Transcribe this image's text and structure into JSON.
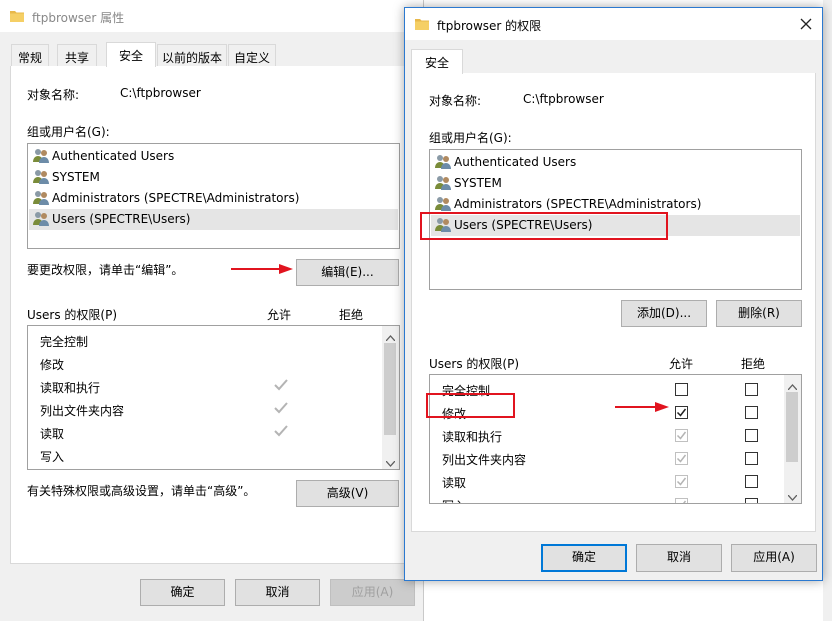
{
  "props_window": {
    "title": "ftpbrowser 属性",
    "tabs": [
      "常规",
      "共享",
      "安全",
      "以前的版本",
      "自定义"
    ],
    "object_name_label": "对象名称:",
    "object_name_value": "C:\\ftpbrowser",
    "group_label": "组或用户名(G):",
    "users": [
      "Authenticated Users",
      "SYSTEM",
      "Administrators (SPECTRE\\Administrators)",
      "Users (SPECTRE\\Users)"
    ],
    "edit_hint": "要更改权限，请单击“编辑”。",
    "edit_button": "编辑(E)...",
    "perm_label": "Users 的权限(P)",
    "allow_header": "允许",
    "deny_header": "拒绝",
    "permissions": [
      {
        "name": "完全控制",
        "allow": false
      },
      {
        "name": "修改",
        "allow": false
      },
      {
        "name": "读取和执行",
        "allow": true
      },
      {
        "name": "列出文件夹内容",
        "allow": true
      },
      {
        "name": "读取",
        "allow": true
      },
      {
        "name": "写入",
        "allow": false
      }
    ],
    "advanced_hint": "有关特殊权限或高级设置，请单击“高级”。",
    "advanced_button": "高级(V)",
    "ok_button": "确定",
    "cancel_button": "取消",
    "apply_button": "应用(A)"
  },
  "perm_window": {
    "title": "ftpbrowser 的权限",
    "tab": "安全",
    "object_name_label": "对象名称:",
    "object_name_value": "C:\\ftpbrowser",
    "group_label": "组或用户名(G):",
    "users": [
      "Authenticated Users",
      "SYSTEM",
      "Administrators (SPECTRE\\Administrators)",
      "Users (SPECTRE\\Users)"
    ],
    "add_button": "添加(D)...",
    "remove_button": "删除(R)",
    "perm_label": "Users 的权限(P)",
    "allow_header": "允许",
    "deny_header": "拒绝",
    "permissions": [
      {
        "name": "完全控制",
        "allow": "unchecked",
        "deny": "unchecked"
      },
      {
        "name": "修改",
        "allow": "checked",
        "deny": "unchecked"
      },
      {
        "name": "读取和执行",
        "allow": "inherited",
        "deny": "unchecked"
      },
      {
        "name": "列出文件夹内容",
        "allow": "inherited",
        "deny": "unchecked"
      },
      {
        "name": "读取",
        "allow": "inherited",
        "deny": "unchecked"
      },
      {
        "name": "写入",
        "allow": "inherited",
        "deny": "unchecked"
      }
    ],
    "ok_button": "确定",
    "cancel_button": "取消",
    "apply_button": "应用(A)",
    "close_icon": "close-icon"
  },
  "colors": {
    "annotation_red": "#e1141f",
    "accent_blue": "#0078d7"
  }
}
